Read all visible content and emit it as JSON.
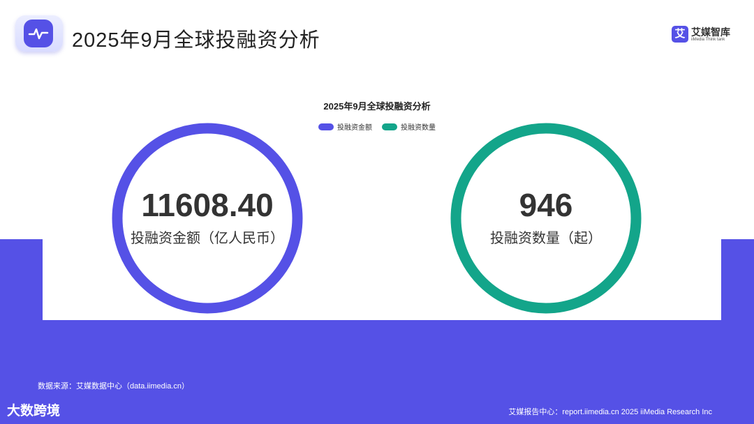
{
  "header": {
    "title": "2025年9月全球投融资分析"
  },
  "logo": {
    "mark": "艾",
    "name": "艾媒智库",
    "subtitle": "iiMedia Think tank"
  },
  "chart_data": {
    "type": "pie",
    "title": "2025年9月全球投融资分析",
    "legend": [
      "投融资金额",
      "投融资数量"
    ],
    "legend_position": "top-center",
    "series": [
      {
        "name": "投融资金额",
        "value": 11608.4,
        "display": "11608.40",
        "label": "投融资金额（亿人民币）",
        "color": "#5551e6",
        "fraction": 1.0
      },
      {
        "name": "投融资数量",
        "value": 946,
        "display": "946",
        "label": "投融资数量（起）",
        "color": "#13a58a",
        "fraction": 1.0
      }
    ]
  },
  "footer": {
    "source": "数据来源：艾媒数据中心（data.iimedia.cn）",
    "brand": "大数跨境",
    "report": "艾媒报告中心：report.iimedia.cn   2025 iiMedia Research Inc"
  },
  "colors": {
    "accent": "#5551e6",
    "secondary": "#13a58a"
  }
}
